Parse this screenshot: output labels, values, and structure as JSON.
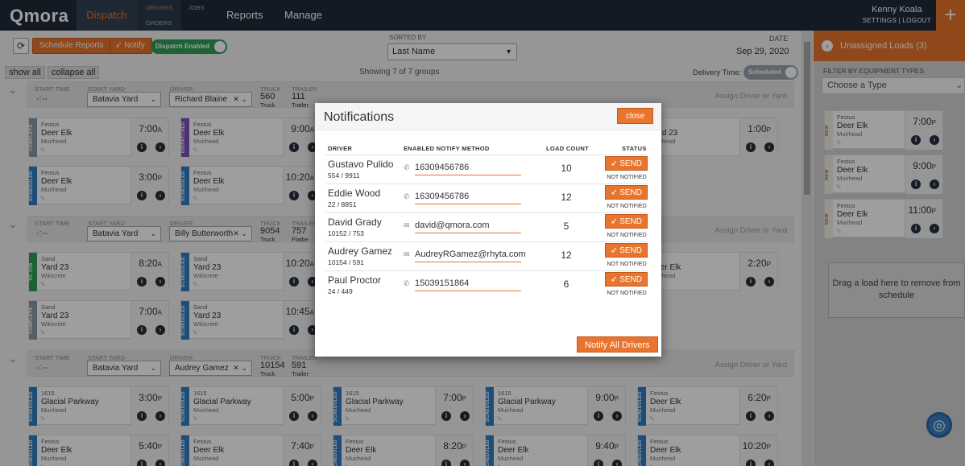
{
  "app": {
    "logo": "Qmora",
    "nav_dispatch": "Dispatch",
    "sub_drivers": "DRIVERS",
    "sub_jobs": "JOBS",
    "sub_orders": "ORDERS",
    "nav_reports": "Reports",
    "nav_manage": "Manage",
    "user_name": "Kenny Koala",
    "user_links": "SETTINGS | LOGOUT",
    "add_icon": "+"
  },
  "toolbar": {
    "refresh_icon": "⟳",
    "schedule_reports": "Schedule Reports",
    "notify": "Notify",
    "notify_icon": "➶",
    "dispatch_toggle": "Dispatch Enabled",
    "sorted_by_label": "SORTED BY",
    "sorted_by_value": "Last Name",
    "date_label": "DATE",
    "date_value": "Sep 29, 2020",
    "show_all": "show all",
    "collapse_all": "collapse all",
    "showing": "Showing 7 of 7 groups",
    "delivery_label": "Delivery Time:",
    "delivery_toggle": "Scheduled"
  },
  "labels": {
    "start_time": "START TIME",
    "start_yard": "START YARD",
    "driver": "DRIVER",
    "truck": "TRUCK",
    "trailer": "TRAILER",
    "assign": "Assign Driver or Yard",
    "time_placeholder": "-:--",
    "truck_sub": "Truck",
    "trailer_sub": "Trailer"
  },
  "groups": [
    {
      "yard": "Batavia Yard",
      "driver": "Richard Blaine",
      "truck": "560",
      "trailer": "111",
      "trailer_sub": "Trailer"
    },
    {
      "yard": "Batavia Yard",
      "driver": "Billy Butterworth",
      "truck": "9054",
      "trailer": "757",
      "trailer_sub": "Flatbe"
    },
    {
      "yard": "Batavia Yard",
      "driver": "Audrey Gamez",
      "truck": "10154",
      "trailer": "591",
      "trailer_sub": "Trailer"
    }
  ],
  "cards": [
    {
      "status": "COMPLETE",
      "color": "#8a97a6",
      "sm": "Festus",
      "name": "Deer Elk",
      "loc": "Muirhead",
      "time": "7:00",
      "ap": "A"
    },
    {
      "status": "DISPATCHED",
      "color": "#7c4fbd",
      "sm": "Festus",
      "name": "Deer Elk",
      "loc": "Muirhead",
      "time": "9:00",
      "ap": "A"
    },
    {
      "status": "SCHEDULED",
      "color": "#2f7fc4",
      "sm": "Festus",
      "name": "Deer Elk",
      "loc": "Muirhead",
      "time": "3:00",
      "ap": "P"
    },
    {
      "status": "SCHEDULED",
      "color": "#2f7fc4",
      "sm": "Festus",
      "name": "Deer Elk",
      "loc": "Muirhead",
      "time": "10:20",
      "ap": "A"
    },
    {
      "status": "TO JOB",
      "color": "#2f9e57",
      "sm": "Sand",
      "name": "Yard 23",
      "loc": "Wikicrete",
      "time": "8:20",
      "ap": "A"
    },
    {
      "status": "SCHEDULED",
      "color": "#2f7fc4",
      "sm": "Sand",
      "name": "Yard 23",
      "loc": "Wikicrete",
      "time": "10:20",
      "ap": "A"
    },
    {
      "status": "COMPLETE",
      "color": "#8a97a6",
      "sm": "Sand",
      "name": "Yard 23",
      "loc": "Wikicrete",
      "time": "7:00",
      "ap": "A"
    },
    {
      "status": "SCHEDULED",
      "color": "#2f7fc4",
      "sm": "Sand",
      "name": "Yard 23",
      "loc": "Wikicrete",
      "time": "10:45",
      "ap": "A"
    },
    {
      "status": "SCHEDULED",
      "color": "#2f7fc4",
      "sm": "1615",
      "name": "Glacial Parkway",
      "loc": "Muirhead",
      "time": "3:00",
      "ap": "P"
    },
    {
      "status": "SCHEDULED",
      "color": "#2f7fc4",
      "sm": "1615",
      "name": "Glacial Parkway",
      "loc": "Muirhead",
      "time": "5:00",
      "ap": "P"
    },
    {
      "status": "SCHEDULED",
      "color": "#2f7fc4",
      "sm": "1615",
      "name": "Glacial Parkway",
      "loc": "Muirhead",
      "time": "7:00",
      "ap": "P"
    },
    {
      "status": "SCHEDULED",
      "color": "#2f7fc4",
      "sm": "1615",
      "name": "Glacial Parkway",
      "loc": "Muirhead",
      "time": "9:00",
      "ap": "P"
    },
    {
      "status": "SCHEDULED",
      "color": "#2f7fc4",
      "sm": "Festus",
      "name": "Deer Elk",
      "loc": "Muirhead",
      "time": "6:20",
      "ap": "P"
    },
    {
      "status": "SCHEDULED",
      "color": "#2f7fc4",
      "sm": "Festus",
      "name": "Deer Elk",
      "loc": "Muirhead",
      "time": "5:40",
      "ap": "P"
    },
    {
      "status": "SCHEDULED",
      "color": "#2f7fc4",
      "sm": "Festus",
      "name": "Deer Elk",
      "loc": "Muirhead",
      "time": "7:40",
      "ap": "P"
    },
    {
      "status": "SCHEDULED",
      "color": "#2f7fc4",
      "sm": "Festus",
      "name": "Deer Elk",
      "loc": "Muirhead",
      "time": "8:20",
      "ap": "P"
    },
    {
      "status": "SCHEDULED",
      "color": "#2f7fc4",
      "sm": "Festus",
      "name": "Deer Elk",
      "loc": "Muirhead",
      "time": "9:40",
      "ap": "P"
    },
    {
      "status": "SCHEDULED",
      "color": "#2f7fc4",
      "sm": "Festus",
      "name": "Deer Elk",
      "loc": "Muirhead",
      "time": "10:20",
      "ap": "P"
    },
    {
      "status": "",
      "color": "#ffffff",
      "sm": "",
      "name": "Yard 23",
      "loc": "Muirhead",
      "time": "1:00",
      "ap": "P"
    },
    {
      "status": "",
      "color": "#ffffff",
      "sm": "",
      "name": "Deer Elk",
      "loc": "Muirhead",
      "time": "2:20",
      "ap": "P"
    }
  ],
  "right": {
    "title": "Unassigned Loads (3)",
    "filter_label": "FILTER BY EQUIPMENT TYPES",
    "filter_value": "Choose a Type",
    "dropzone": "Drag a load here to remove from schedule",
    "cards": [
      {
        "status": "NEW",
        "color": "#f2efe5",
        "sm": "Festus",
        "name": "Deer Elk",
        "loc": "Muirhead",
        "time": "7:00",
        "ap": "P"
      },
      {
        "status": "NEW",
        "color": "#f2efe5",
        "sm": "Festus",
        "name": "Deer Elk",
        "loc": "Muirhead",
        "time": "9:00",
        "ap": "P"
      },
      {
        "status": "NEW",
        "color": "#f2efe5",
        "sm": "Festus",
        "name": "Deer Elk",
        "loc": "Muirhead",
        "time": "11:00",
        "ap": "P"
      }
    ]
  },
  "modal": {
    "title": "Notifications",
    "close": "close",
    "col_driver": "DRIVER",
    "col_method": "ENABLED NOTIFY METHOD",
    "col_count": "LOAD COUNT",
    "col_status": "STATUS",
    "send": "SEND",
    "not_notified": "NOT NOTIFIED",
    "notify_all": "Notify All Drivers",
    "rows": [
      {
        "name": "Gustavo Pulido",
        "sub": "554 / 9911",
        "icon": "phone",
        "method": "16309456786",
        "count": "10"
      },
      {
        "name": "Eddie Wood",
        "sub": "22 / 8851",
        "icon": "phone",
        "method": "16309456786",
        "count": "12"
      },
      {
        "name": "David Grady",
        "sub": "10152 / 753",
        "icon": "mail",
        "method": "david@qmora.com",
        "count": "5"
      },
      {
        "name": "Audrey Gamez",
        "sub": "10154 / 591",
        "icon": "mail",
        "method": "AudreyRGamez@rhyta.com",
        "count": "12"
      },
      {
        "name": "Paul Proctor",
        "sub": "24 / 449",
        "icon": "phone",
        "method": "15039151864",
        "count": "6"
      }
    ]
  },
  "colors": {
    "accent": "#e9742d",
    "nav": "#1f2b3a",
    "scheduled": "#2f7fc4",
    "complete": "#8a97a6",
    "dispatched": "#7c4fbd",
    "tojob": "#2f9e57"
  }
}
